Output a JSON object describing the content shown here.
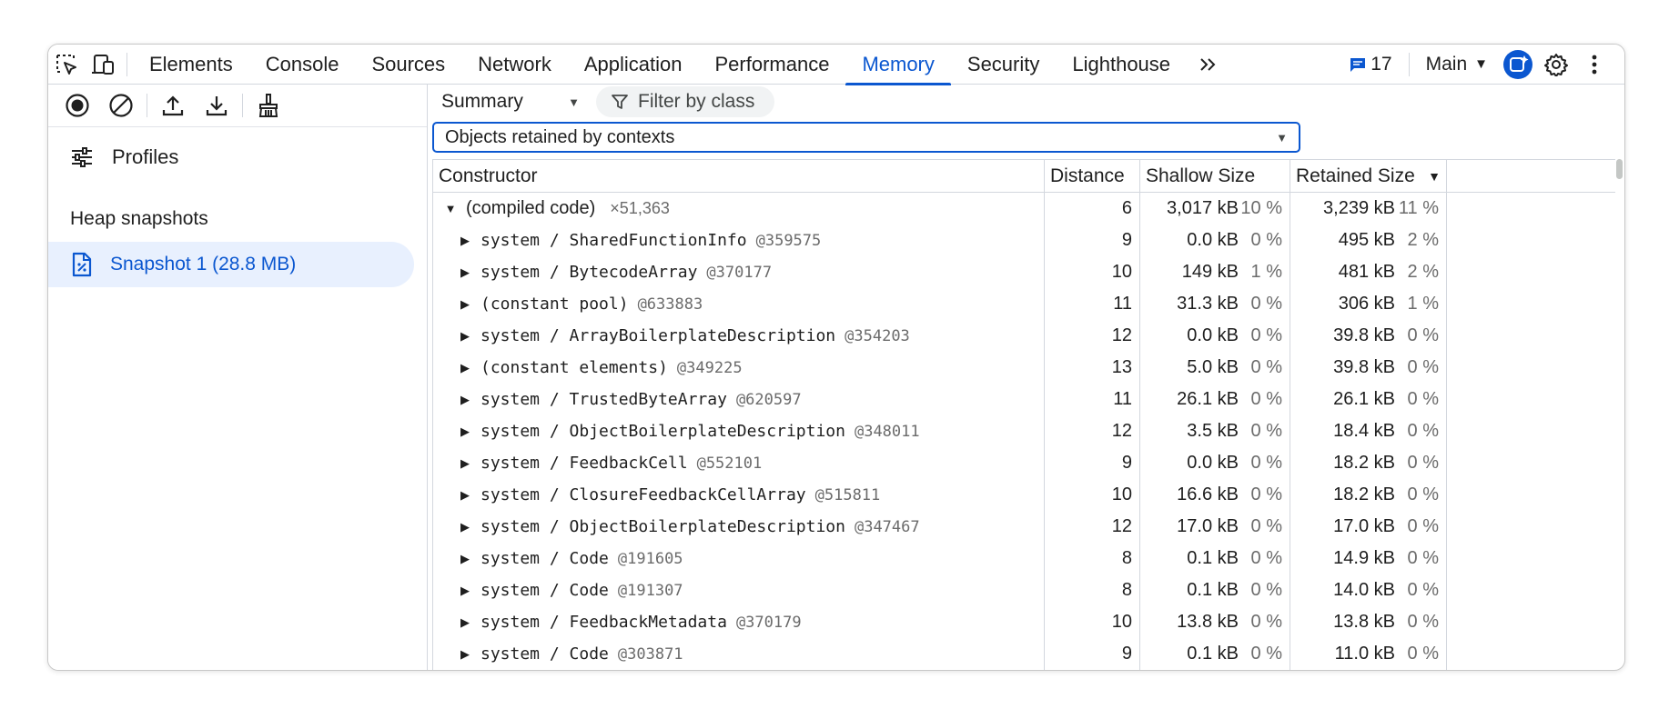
{
  "tabs": [
    "Elements",
    "Console",
    "Sources",
    "Network",
    "Application",
    "Performance",
    "Memory",
    "Security",
    "Lighthouse"
  ],
  "active_tab": "Memory",
  "issues_count": "17",
  "target": "Main",
  "sidebar": {
    "profiles_label": "Profiles",
    "heap_snapshots_title": "Heap snapshots",
    "snapshot_label": "Snapshot 1 (28.8 MB)"
  },
  "toolbar": {
    "view_select": "Summary",
    "filter_placeholder": "Filter by class",
    "retained_select": "Objects retained by contexts"
  },
  "columns": {
    "constructor": "Constructor",
    "distance": "Distance",
    "shallow": "Shallow Size",
    "retained": "Retained Size"
  },
  "rows": [
    {
      "name": "(compiled code)",
      "count": "×51,363",
      "mono": false,
      "expanded": true,
      "indent": 0,
      "distance": "6",
      "shallow": "3,017 kB",
      "shallow_pct": "10 %",
      "retained": "3,239 kB",
      "retained_pct": "11 %"
    },
    {
      "name": "system / SharedFunctionInfo",
      "id": "@359575",
      "mono": true,
      "indent": 1,
      "distance": "9",
      "shallow": "0.0 kB",
      "shallow_pct": "0 %",
      "retained": "495 kB",
      "retained_pct": "2 %"
    },
    {
      "name": "system / BytecodeArray",
      "id": "@370177",
      "mono": true,
      "indent": 1,
      "distance": "10",
      "shallow": "149 kB",
      "shallow_pct": "1 %",
      "retained": "481 kB",
      "retained_pct": "2 %"
    },
    {
      "name": "(constant pool)",
      "id": "@633883",
      "mono": true,
      "indent": 1,
      "distance": "11",
      "shallow": "31.3 kB",
      "shallow_pct": "0 %",
      "retained": "306 kB",
      "retained_pct": "1 %"
    },
    {
      "name": "system / ArrayBoilerplateDescription",
      "id": "@354203",
      "mono": true,
      "indent": 1,
      "distance": "12",
      "shallow": "0.0 kB",
      "shallow_pct": "0 %",
      "retained": "39.8 kB",
      "retained_pct": "0 %"
    },
    {
      "name": "(constant elements)",
      "id": "@349225",
      "mono": true,
      "indent": 1,
      "distance": "13",
      "shallow": "5.0 kB",
      "shallow_pct": "0 %",
      "retained": "39.8 kB",
      "retained_pct": "0 %"
    },
    {
      "name": "system / TrustedByteArray",
      "id": "@620597",
      "mono": true,
      "indent": 1,
      "distance": "11",
      "shallow": "26.1 kB",
      "shallow_pct": "0 %",
      "retained": "26.1 kB",
      "retained_pct": "0 %"
    },
    {
      "name": "system / ObjectBoilerplateDescription",
      "id": "@348011",
      "mono": true,
      "indent": 1,
      "distance": "12",
      "shallow": "3.5 kB",
      "shallow_pct": "0 %",
      "retained": "18.4 kB",
      "retained_pct": "0 %"
    },
    {
      "name": "system / FeedbackCell",
      "id": "@552101",
      "mono": true,
      "indent": 1,
      "distance": "9",
      "shallow": "0.0 kB",
      "shallow_pct": "0 %",
      "retained": "18.2 kB",
      "retained_pct": "0 %"
    },
    {
      "name": "system / ClosureFeedbackCellArray",
      "id": "@515811",
      "mono": true,
      "indent": 1,
      "distance": "10",
      "shallow": "16.6 kB",
      "shallow_pct": "0 %",
      "retained": "18.2 kB",
      "retained_pct": "0 %"
    },
    {
      "name": "system / ObjectBoilerplateDescription",
      "id": "@347467",
      "mono": true,
      "indent": 1,
      "distance": "12",
      "shallow": "17.0 kB",
      "shallow_pct": "0 %",
      "retained": "17.0 kB",
      "retained_pct": "0 %"
    },
    {
      "name": "system / Code",
      "id": "@191605",
      "mono": true,
      "indent": 1,
      "distance": "8",
      "shallow": "0.1 kB",
      "shallow_pct": "0 %",
      "retained": "14.9 kB",
      "retained_pct": "0 %"
    },
    {
      "name": "system / Code",
      "id": "@191307",
      "mono": true,
      "indent": 1,
      "distance": "8",
      "shallow": "0.1 kB",
      "shallow_pct": "0 %",
      "retained": "14.0 kB",
      "retained_pct": "0 %"
    },
    {
      "name": "system / FeedbackMetadata",
      "id": "@370179",
      "mono": true,
      "indent": 1,
      "distance": "10",
      "shallow": "13.8 kB",
      "shallow_pct": "0 %",
      "retained": "13.8 kB",
      "retained_pct": "0 %"
    },
    {
      "name": "system / Code",
      "id": "@303871",
      "mono": true,
      "indent": 1,
      "distance": "9",
      "shallow": "0.1 kB",
      "shallow_pct": "0 %",
      "retained": "11.0 kB",
      "retained_pct": "0 %"
    }
  ]
}
